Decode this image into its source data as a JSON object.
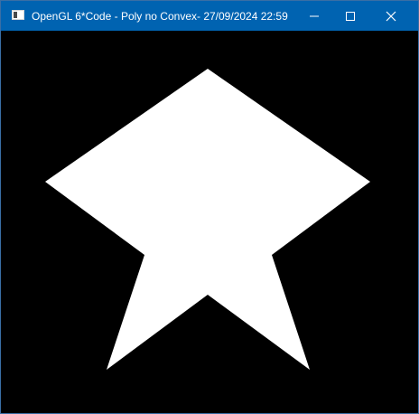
{
  "window": {
    "title": "OpenGL 6*Code - Poly no Convex- 27/09/2024 22:59",
    "titlebar_color": "#0063b1",
    "canvas_color": "#000000",
    "shape_color": "#ffffff",
    "icons": {
      "app": "app-window-icon",
      "minimize": "minimize-icon",
      "maximize": "maximize-icon",
      "close": "close-icon"
    }
  }
}
